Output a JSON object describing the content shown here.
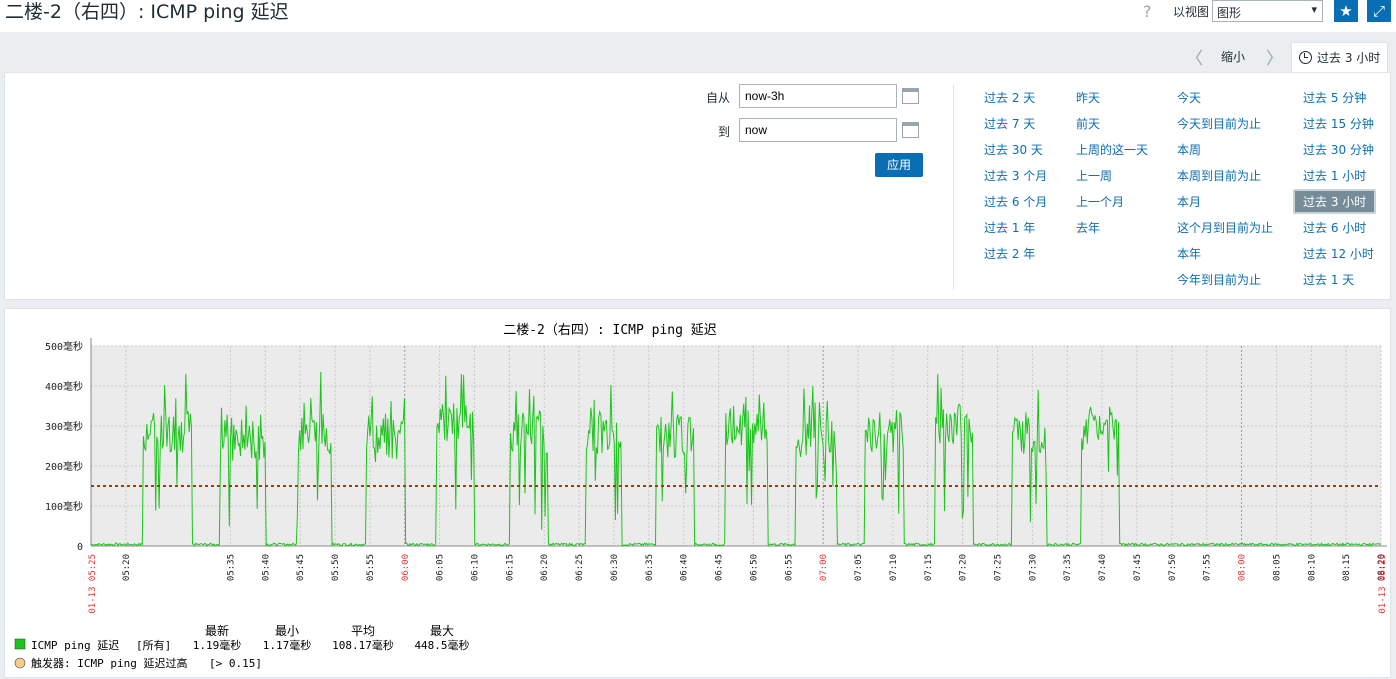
{
  "header": {
    "title": "二楼-2（右四）: ICMP ping 延迟",
    "help_icon": "?",
    "view_label": "以视图",
    "view_selected": "图形",
    "favorite_icon": "★",
    "fullscreen_icon": "⤢"
  },
  "timebar": {
    "prev_icon": "〈",
    "zoom_out": "缩小",
    "next_icon": "〉",
    "active_tab": "过去 3 小时"
  },
  "filter": {
    "from_label": "自从",
    "from_value": "now-3h",
    "to_label": "到",
    "to_value": "now",
    "apply_label": "应用",
    "quick_columns": [
      [
        "过去 2 天",
        "过去 7 天",
        "过去 30 天",
        "过去 3 个月",
        "过去 6 个月",
        "过去 1 年",
        "过去 2 年"
      ],
      [
        "昨天",
        "前天",
        "上周的这一天",
        "上一周",
        "上一个月",
        "去年"
      ],
      [
        "今天",
        "今天到目前为止",
        "本周",
        "本周到目前为止",
        "本月",
        "这个月到目前为止",
        "本年",
        "今年到目前为止"
      ],
      [
        "过去 5 分钟",
        "过去 15 分钟",
        "过去 30 分钟",
        "过去 1 小时",
        "过去 3 小时",
        "过去 6 小时",
        "过去 12 小时",
        "过去 1 天"
      ]
    ],
    "active_quick": "过去 3 小时"
  },
  "colors": {
    "series": "#1ec41e",
    "trigger": "#a04000",
    "link": "#0a6eb4",
    "plot_bg": "#ebebeb",
    "red_label": "#e33734"
  },
  "chart_data": {
    "type": "line",
    "title": "二楼-2（右四）: ICMP ping 延迟",
    "y_ticks": [
      "0",
      "100毫秒",
      "200毫秒",
      "300毫秒",
      "400毫秒",
      "500毫秒"
    ],
    "ylim": [
      0,
      500
    ],
    "y_unit": "毫秒",
    "x_range_labels": [
      "01-13 05:25",
      "01-13 08:25"
    ],
    "x_ticks": [
      {
        "label": "05:20",
        "min": 0
      },
      {
        "label": "05:35",
        "min": 15
      },
      {
        "label": "05:40",
        "min": 20
      },
      {
        "label": "05:45",
        "min": 25
      },
      {
        "label": "05:50",
        "min": 30
      },
      {
        "label": "05:55",
        "min": 35
      },
      {
        "label": "06:00",
        "min": 40,
        "red": true
      },
      {
        "label": "06:05",
        "min": 45
      },
      {
        "label": "06:10",
        "min": 50
      },
      {
        "label": "06:15",
        "min": 55
      },
      {
        "label": "06:20",
        "min": 60
      },
      {
        "label": "06:25",
        "min": 65
      },
      {
        "label": "06:30",
        "min": 70
      },
      {
        "label": "06:35",
        "min": 75
      },
      {
        "label": "06:40",
        "min": 80
      },
      {
        "label": "06:45",
        "min": 85
      },
      {
        "label": "06:50",
        "min": 90
      },
      {
        "label": "06:55",
        "min": 95
      },
      {
        "label": "07:00",
        "min": 100,
        "red": true
      },
      {
        "label": "07:05",
        "min": 105
      },
      {
        "label": "07:10",
        "min": 110
      },
      {
        "label": "07:15",
        "min": 115
      },
      {
        "label": "07:20",
        "min": 120
      },
      {
        "label": "07:25",
        "min": 125
      },
      {
        "label": "07:30",
        "min": 130
      },
      {
        "label": "07:35",
        "min": 135
      },
      {
        "label": "07:40",
        "min": 140
      },
      {
        "label": "07:45",
        "min": 145
      },
      {
        "label": "07:50",
        "min": 150
      },
      {
        "label": "07:55",
        "min": 155
      },
      {
        "label": "08:00",
        "min": 160,
        "red": true
      },
      {
        "label": "08:05",
        "min": 165
      },
      {
        "label": "08:10",
        "min": 170
      },
      {
        "label": "08:15",
        "min": 175
      },
      {
        "label": "08:20",
        "min": 180
      }
    ],
    "trigger_threshold": 150,
    "bursts": [
      {
        "start": 2.5,
        "end": 9.5,
        "level": 300,
        "peak": 445
      },
      {
        "start": 13.5,
        "end": 20,
        "level": 280,
        "peak": 380
      },
      {
        "start": 24.5,
        "end": 29.5,
        "level": 300,
        "peak": 440
      },
      {
        "start": 34.5,
        "end": 40,
        "level": 280,
        "peak": 420
      },
      {
        "start": 44.5,
        "end": 50,
        "level": 320,
        "peak": 448
      },
      {
        "start": 55,
        "end": 60.5,
        "level": 300,
        "peak": 400
      },
      {
        "start": 66,
        "end": 71,
        "level": 300,
        "peak": 410
      },
      {
        "start": 76,
        "end": 81.5,
        "level": 290,
        "peak": 410
      },
      {
        "start": 86,
        "end": 92,
        "level": 320,
        "peak": 440
      },
      {
        "start": 96,
        "end": 102,
        "level": 280,
        "peak": 410
      },
      {
        "start": 106,
        "end": 111.5,
        "level": 300,
        "peak": 420
      },
      {
        "start": 116,
        "end": 121.5,
        "level": 320,
        "peak": 440
      },
      {
        "start": 127,
        "end": 132,
        "level": 300,
        "peak": 400
      },
      {
        "start": 137,
        "end": 142.5,
        "level": 310,
        "peak": 320
      }
    ],
    "legend": {
      "headers": [
        "最新",
        "最小",
        "平均",
        "最大"
      ],
      "series_name": "ICMP ping 延迟",
      "series_scope": "[所有]",
      "values": [
        "1.19毫秒",
        "1.17毫秒",
        "108.17毫秒",
        "448.5毫秒"
      ],
      "trigger_label": "触发器: ICMP ping 延迟过高",
      "trigger_expr": "[> 0.15]"
    }
  }
}
